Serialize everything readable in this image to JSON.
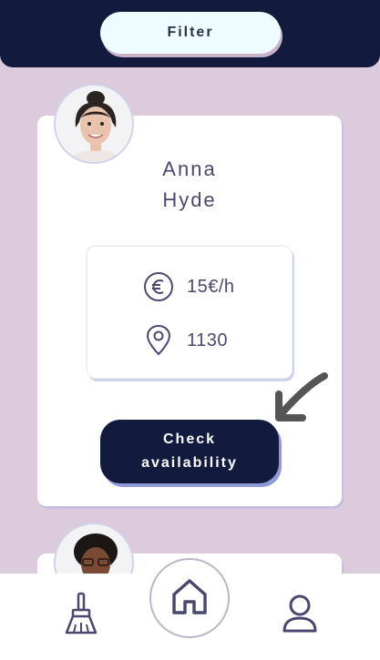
{
  "header": {
    "filter_label": "Filter"
  },
  "cards": [
    {
      "first_name": "Anna",
      "last_name": "Hyde",
      "price": "15€/h",
      "location": "1130",
      "cta_line1": "Check",
      "cta_line2": "availability"
    }
  ],
  "icons": {
    "price": "euro-icon",
    "location": "location-pin-icon",
    "arrow": "arrow-icon",
    "nav_left": "broom-icon",
    "nav_center": "home-icon",
    "nav_right": "user-icon"
  },
  "colors": {
    "header_bg": "#121a3d",
    "page_bg": "#dccbdc",
    "filter_bg": "#eefbff",
    "cta_bg": "#121a3d",
    "cta_shadow": "#8f9ad6",
    "text": "#4a4870"
  }
}
